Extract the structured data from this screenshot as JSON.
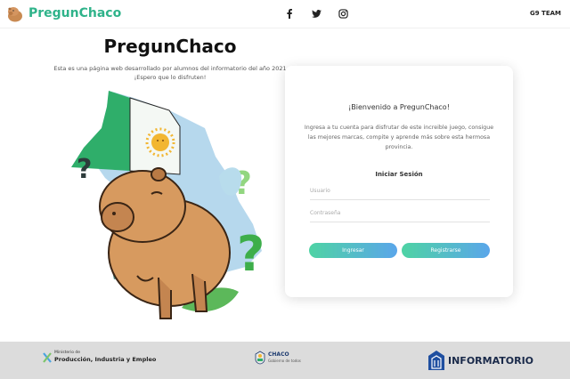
{
  "nav": {
    "brand": "PregunChaco",
    "social_icons": [
      "facebook-icon",
      "twitter-icon",
      "instagram-icon"
    ],
    "team": "G9 TEAM"
  },
  "hero": {
    "title": "PregunChaco",
    "subtitle_line1": "Esta es una página web desarrollado por alumnos del informatorio del año 2021",
    "subtitle_line2": "¡Espero que lo disfruten!"
  },
  "card": {
    "title": "¡Bienvenido a PregunChaco!",
    "text": "Ingresa a tu cuenta para disfrutar de este increible juego, consigue las mejores marcas, compite y aprende más sobre esta hermosa provincia.",
    "login_heading": "Iniciar Sesión",
    "user_placeholder": "Usuario",
    "user_value": "",
    "pass_placeholder": "Contraseña",
    "pass_value": "",
    "login_button": "Ingresar",
    "register_button": "Registrarse"
  },
  "footer": {
    "ministry_small": "Ministerio de",
    "ministry_big": "Producción, Industria y Empleo",
    "chaco_big": "CHACO",
    "chaco_small": "Gobierno de todos",
    "informatorio": "INFORMATORIO"
  },
  "colors": {
    "brand_green": "#2fb38a",
    "button_gradient_start": "#4ed3a4",
    "button_gradient_end": "#5aa6ea",
    "footer_bg": "#dcdcdc"
  }
}
